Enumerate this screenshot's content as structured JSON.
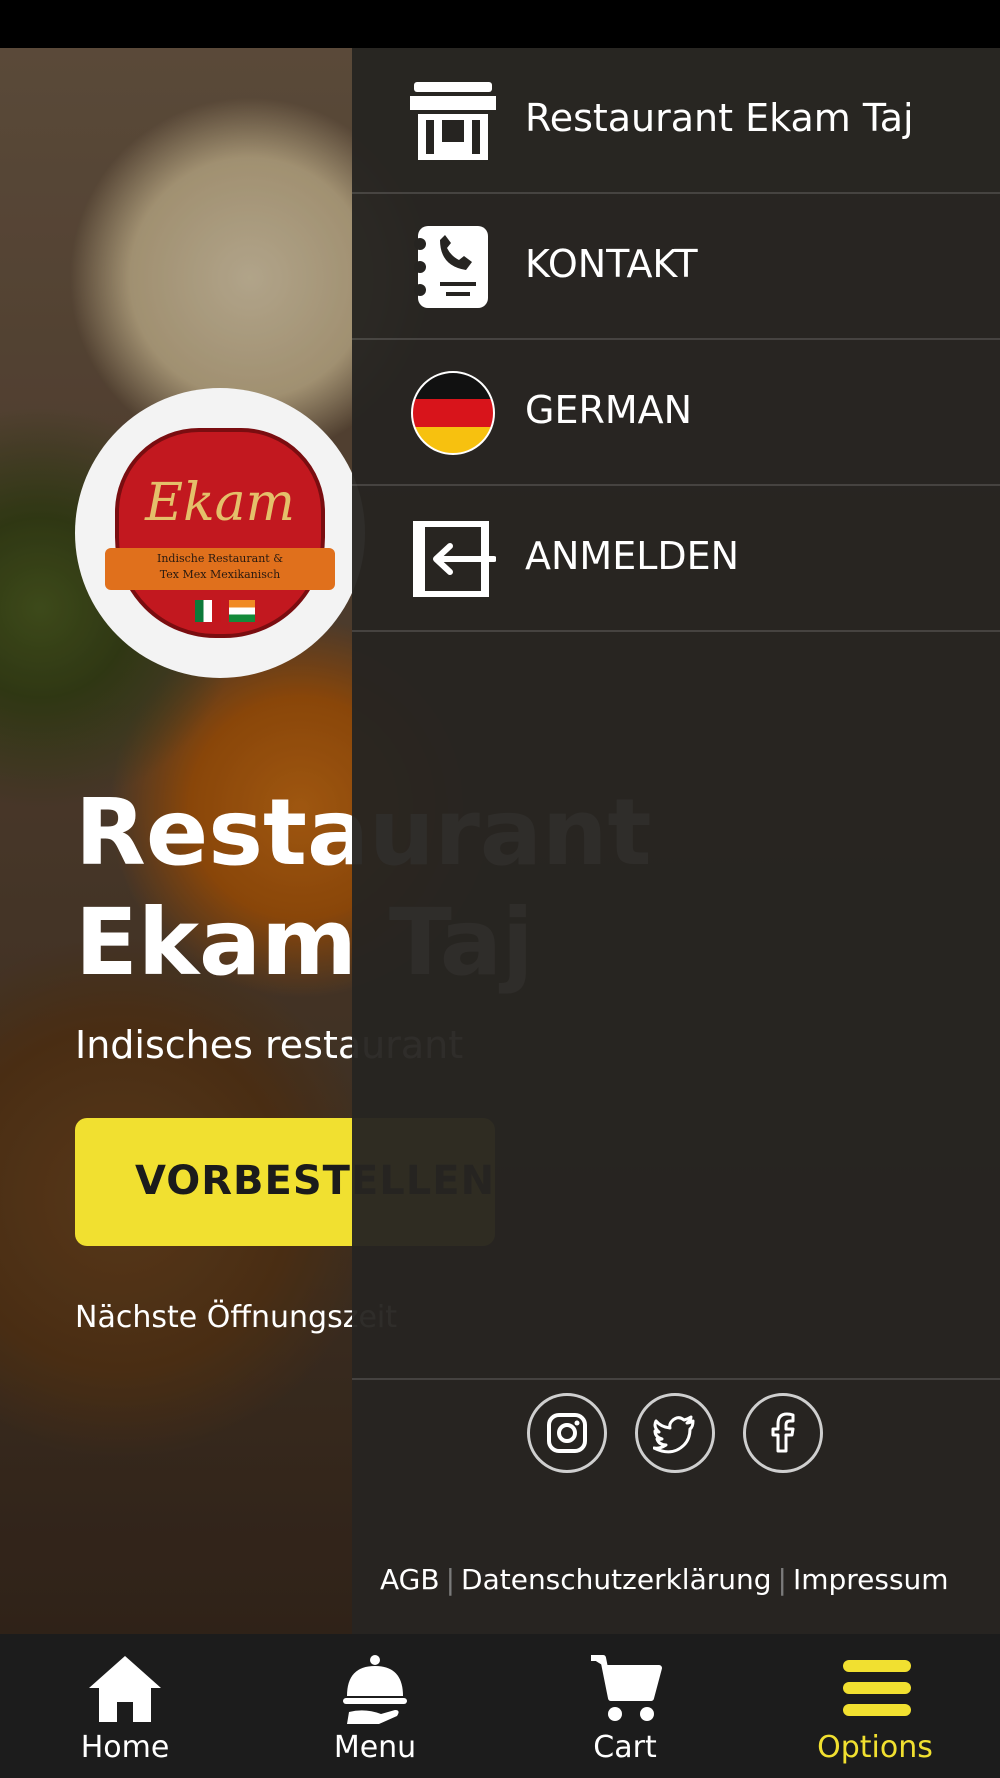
{
  "page": {
    "hero_title": "Restaurant\nEkam Taj",
    "hero_subtitle": "Indisches restaurant",
    "order_button": "VORBESTELLEN",
    "next_opening": "Nächste Öffnungszeit",
    "logo": {
      "name": "Ekam",
      "line1": "Indische Restaurant &",
      "line2": "Tex Mex Mexikanisch"
    }
  },
  "drawer": {
    "items": [
      {
        "label": "Restaurant Ekam Taj",
        "icon": "store-icon"
      },
      {
        "label": "KONTAKT",
        "icon": "contact-book-icon"
      },
      {
        "label": "GERMAN",
        "icon": "german-flag-icon"
      },
      {
        "label": "ANMELDEN",
        "icon": "login-icon"
      }
    ],
    "social": [
      "instagram-icon",
      "twitter-icon",
      "facebook-icon"
    ],
    "footer": {
      "agb": "AGB",
      "privacy": "Datenschutzerklärung",
      "impressum": "Impressum"
    }
  },
  "nav": {
    "items": [
      {
        "label": "Home",
        "icon": "home-icon",
        "active": false
      },
      {
        "label": "Menu",
        "icon": "cloche-icon",
        "active": false
      },
      {
        "label": "Cart",
        "icon": "cart-icon",
        "active": false
      },
      {
        "label": "Options",
        "icon": "hamburger-icon",
        "active": true
      }
    ]
  },
  "colors": {
    "accent": "#f1e030",
    "drawer_bg": "#262421",
    "nav_bg": "#1c1c1c"
  }
}
